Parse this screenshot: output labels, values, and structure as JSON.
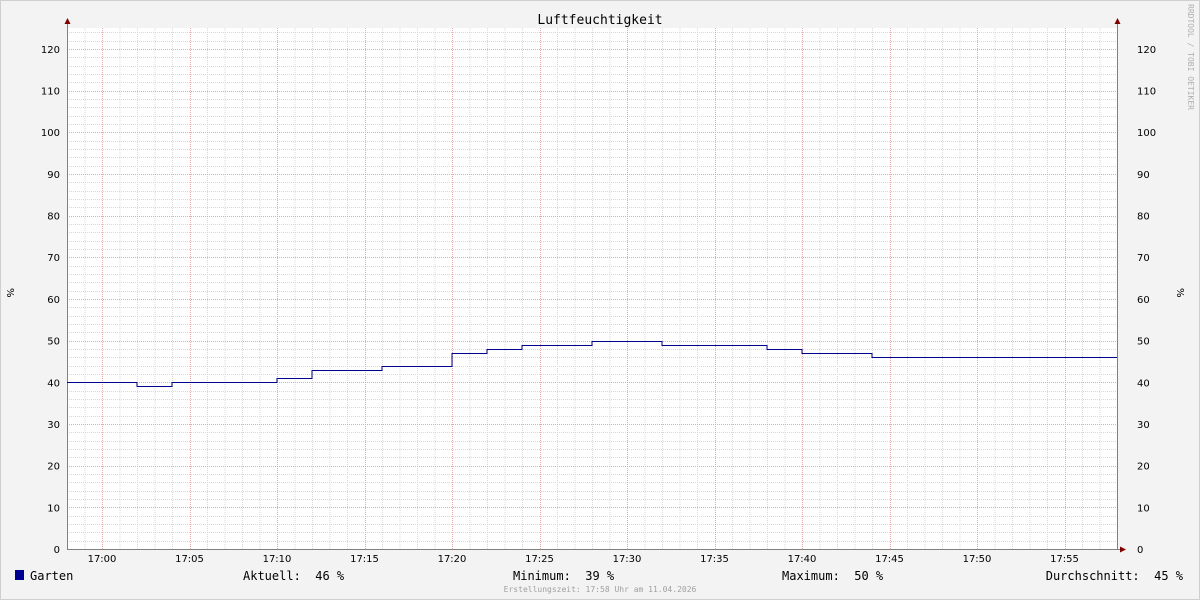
{
  "chart_data": {
    "type": "line",
    "title": "Luftfeuchtigkeit",
    "ylabel": "%",
    "ylabel_right": "%",
    "ylim": [
      0,
      125
    ],
    "y_ticks": [
      0,
      10,
      20,
      30,
      40,
      50,
      60,
      70,
      80,
      90,
      100,
      110,
      120
    ],
    "x_range_minutes": [
      -2,
      58
    ],
    "x_ticks": [
      {
        "minute": 0,
        "label": "17:00"
      },
      {
        "minute": 5,
        "label": "17:05"
      },
      {
        "minute": 10,
        "label": "17:10"
      },
      {
        "minute": 15,
        "label": "17:15"
      },
      {
        "minute": 20,
        "label": "17:20"
      },
      {
        "minute": 25,
        "label": "17:25"
      },
      {
        "minute": 30,
        "label": "17:30"
      },
      {
        "minute": 35,
        "label": "17:35"
      },
      {
        "minute": 40,
        "label": "17:40"
      },
      {
        "minute": 45,
        "label": "17:45"
      },
      {
        "minute": 50,
        "label": "17:50"
      },
      {
        "minute": 55,
        "label": "17:55"
      }
    ],
    "grid": true,
    "series": [
      {
        "name": "Garten",
        "color": "#000090",
        "x": [
          -2,
          2,
          4,
          10,
          12,
          16,
          20,
          22,
          24,
          28,
          32,
          38,
          40,
          44,
          58
        ],
        "values": [
          40,
          39,
          40,
          41,
          43,
          44,
          47,
          48,
          49,
          50,
          49,
          48,
          47,
          46,
          46
        ]
      }
    ]
  },
  "watermark": "RRDTOOL / TOBI OETIKER",
  "legend": {
    "series_name": "Garten",
    "swatch_color": "#000090",
    "current": "Aktuell:  46 %",
    "minimum": "Minimum:  39 %",
    "maximum": "Maximum:  50 %",
    "average": "Durchschnitt:  45 %"
  },
  "footer": "Erstellungszeit: 17:58 Uhr am 11.04.2026",
  "colors": {
    "background": "#f3f3f3",
    "plot_background": "#ffffff",
    "major_grid": "#e8a8a8",
    "minor_grid": "#d8d8d8",
    "axis": "#808080",
    "arrow": "#800000"
  }
}
